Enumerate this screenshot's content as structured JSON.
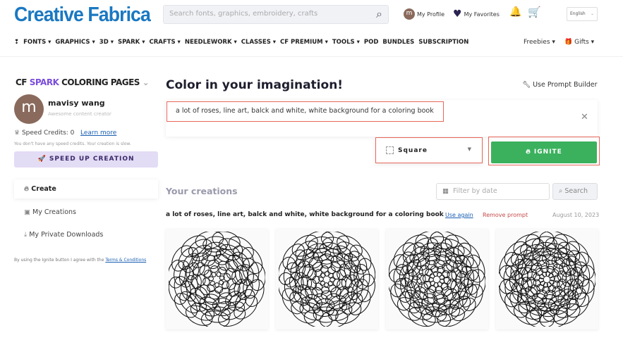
{
  "header": {
    "logo": "Creative Fabrica",
    "search_placeholder": "Search fonts, graphics, embroidery, crafts",
    "avatar_letter": "m",
    "my_profile": "My Profile",
    "my_favorites": "My Favorites",
    "language": "English"
  },
  "nav": {
    "items": [
      "FONTS ▾",
      "GRAPHICS ▾",
      "3D ▾",
      "SPARK ▾",
      "CRAFTS ▾",
      "NEEDLEWORK ▾",
      "CLASSES ▾",
      "CF PREMIUM ▾",
      "TOOLS ▾",
      "POD",
      "BUNDLES",
      "SUBSCRIPTION"
    ],
    "freebies": "Freebies ▾",
    "gifts": "Gifts ▾"
  },
  "sidebar": {
    "brand_cf": "CF",
    "brand_spark": "SPARK",
    "brand_rest": "COLORING PAGES",
    "user_name": "mavisy wang",
    "user_subtitle": "Awesome content creator",
    "speed_credits": "Speed Credits: 0",
    "learn_more": "Learn more",
    "credits_note": "You don't have any speed credits. Your creation is slow.",
    "speed_up": "SPEED UP CREATION",
    "menu": [
      "Create",
      "My Creations",
      "My Private Downloads"
    ],
    "terms_prefix": "By using the Ignite button I agree with the ",
    "terms_link": "Terms & Conditions"
  },
  "main": {
    "title": "Color in your imagination!",
    "prompt_builder": "Use Prompt Builder",
    "prompt": "a lot of roses, line art, balck and white, white background for a coloring book",
    "aspect": "Square",
    "ignite": "IGNITE",
    "your_creations": "Your creations",
    "filter_placeholder": "Filter by date",
    "search": "Search",
    "creation": {
      "prompt": "a lot of roses, line art, balck and white, white background for a coloring book",
      "use_again": "Use again",
      "remove": "Remove prompt",
      "date": "August 10, 2023"
    }
  },
  "colors": {
    "brand": "#1a78c2",
    "ignite": "#3bb15d",
    "highlight": "#e8675a",
    "speed_up_bg": "#e3dcf5"
  }
}
